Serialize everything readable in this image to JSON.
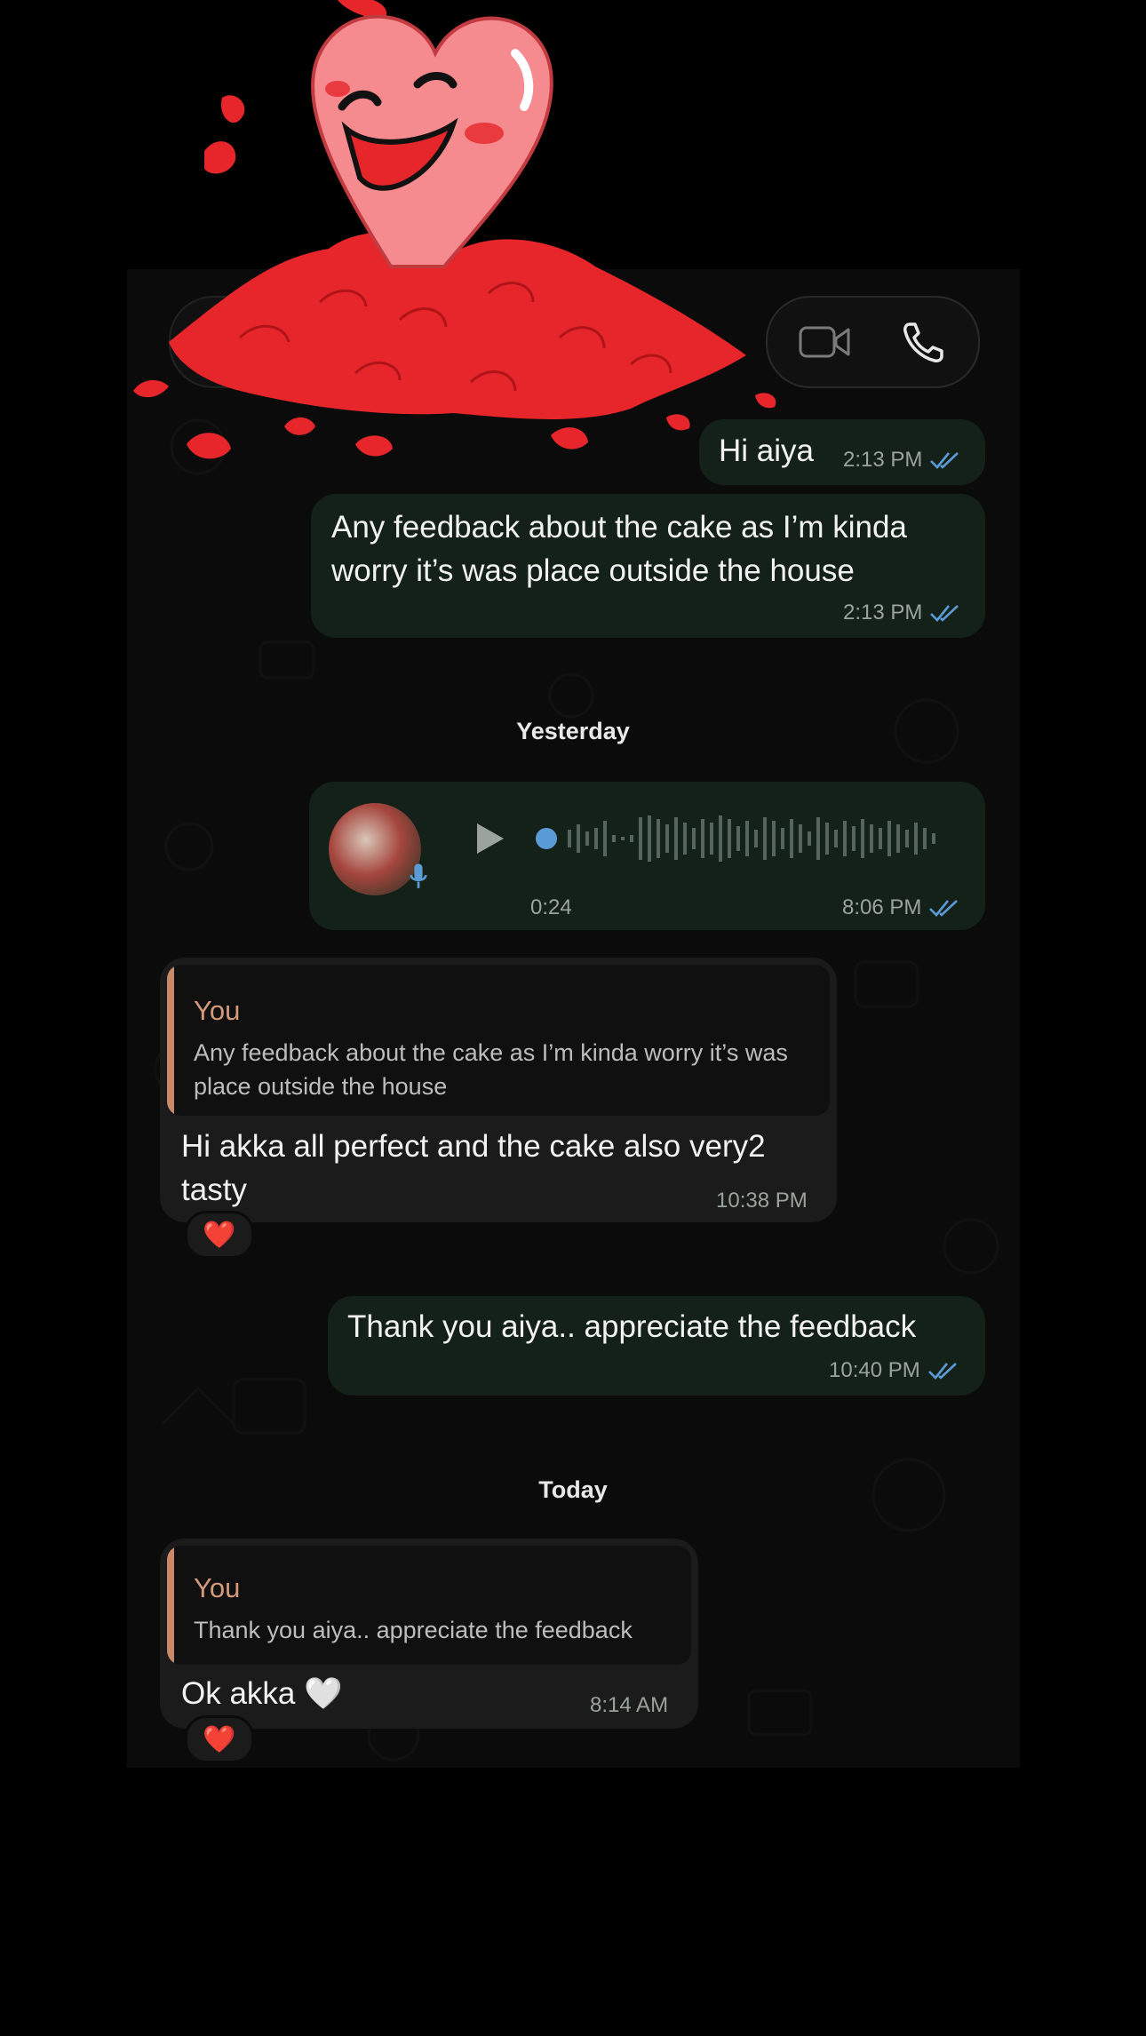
{
  "chat": {
    "messages": [
      {
        "text": "Hi aiya",
        "time": "2:13 PM"
      },
      {
        "text": "Any feedback about the cake as I’m kinda worry it’s was place outside the house",
        "time": "2:13 PM"
      }
    ],
    "yesterday_label": "Yesterday",
    "voice_note": {
      "duration": "0:24",
      "time": "8:06 PM"
    },
    "reply1": {
      "quote_author": "You",
      "quote_text": "Any feedback about the cake as I’m kinda worry it’s was place outside the house",
      "text": "Hi akka all perfect and the cake also very2 tasty",
      "time": "10:38 PM",
      "reaction": "❤️"
    },
    "thanks": {
      "text": "Thank you aiya.. appreciate the feedback",
      "time": "10:40 PM"
    },
    "today_label": "Today",
    "reply2": {
      "quote_author": "You",
      "quote_text": "Thank you aiya.. appreciate the feedback",
      "text": "Ok akka 🤍",
      "time": "8:14 AM",
      "reaction": "❤️"
    }
  },
  "colors": {
    "outgoing_bubble": "#142118",
    "incoming_bubble": "#1b1b1b",
    "read_ticks": "#5b9bd5",
    "quote_accent": "#c98a6a",
    "sticker_red": "#e6262b"
  },
  "icons": [
    "video-call-icon",
    "phone-call-icon",
    "play-icon",
    "mic-icon",
    "double-tick-icon",
    "heart-sticker"
  ]
}
